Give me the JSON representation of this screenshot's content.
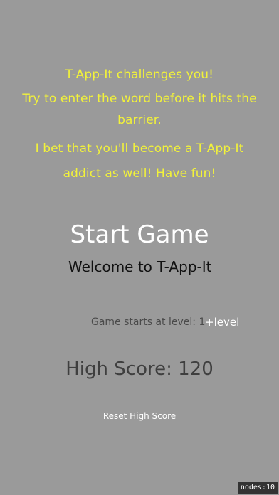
{
  "intro": {
    "line1": "T-App-It challenges you!",
    "line2": "Try to enter the word before it hits the barrier.",
    "line3": "I bet that you'll become a T-App-It",
    "line4": "addict as well! Have fun!"
  },
  "menu": {
    "start_game_label": "Start Game",
    "welcome_text": "Welcome to T-App-It",
    "level_label": "Game starts at level: 1",
    "plus_level_label": "+level",
    "high_score_label": "High Score: 120",
    "reset_high_score_label": "Reset High Score"
  },
  "debug": {
    "nodes_label": "nodes:10"
  },
  "colors": {
    "background": "#9a9a9a",
    "intro_text": "#f2f23a",
    "start_game": "#ffffff",
    "welcome": "#111111",
    "high_score": "#3f3f3f"
  }
}
